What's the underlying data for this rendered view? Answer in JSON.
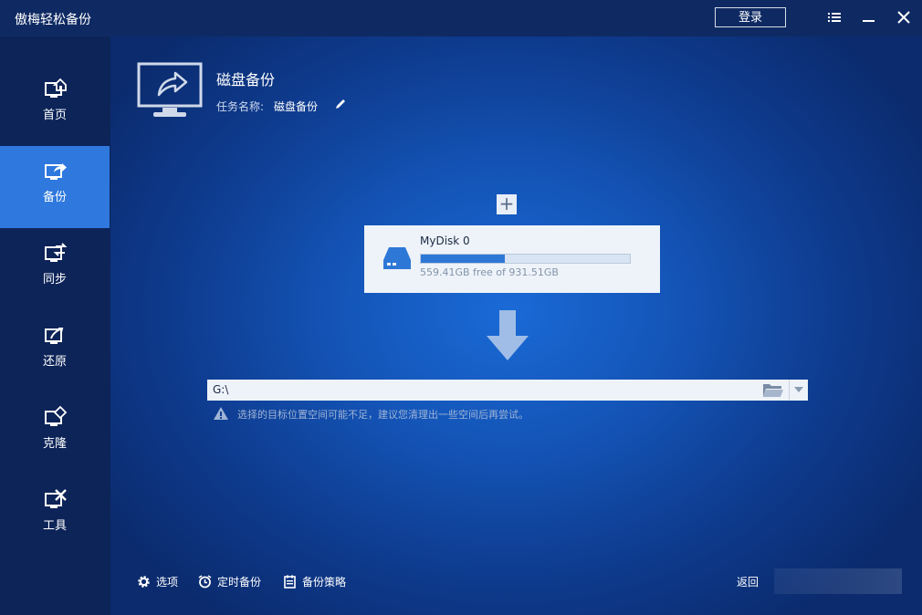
{
  "app": {
    "title": "傲梅轻松备份"
  },
  "titlebar": {
    "login_label": "登录",
    "icons": [
      "menu-icon",
      "minimize-icon",
      "close-icon"
    ]
  },
  "sidebar": {
    "items": [
      {
        "label": "首页",
        "icon": "home-monitor-icon",
        "active": false
      },
      {
        "label": "备份",
        "icon": "backup-monitor-icon",
        "active": true
      },
      {
        "label": "同步",
        "icon": "sync-monitor-icon",
        "active": false
      },
      {
        "label": "还原",
        "icon": "restore-monitor-icon",
        "active": false
      },
      {
        "label": "克隆",
        "icon": "clone-monitor-icon",
        "active": false
      },
      {
        "label": "工具",
        "icon": "tools-monitor-icon",
        "active": false
      }
    ]
  },
  "task": {
    "title": "磁盘备份",
    "name_label": "任务名称:",
    "name_value": "磁盘备份"
  },
  "source": {
    "add_label": "+",
    "disk_name": "MyDisk 0",
    "usage_fraction": 0.4,
    "free_text": "559.41GB free of 931.51GB"
  },
  "destination": {
    "path": "G:\\",
    "warning": "选择的目标位置空间可能不足，建议您清理出一些空间后再尝试。"
  },
  "footer": {
    "options_label": "选项",
    "schedule_label": "定时备份",
    "scheme_label": "备份策略",
    "back_label": "返回"
  },
  "colors": {
    "accent": "#2e78de",
    "sidebar_bg": "#0d2458",
    "titlebar_bg": "#0f2a63",
    "panel_bg": "#eef3f9"
  }
}
